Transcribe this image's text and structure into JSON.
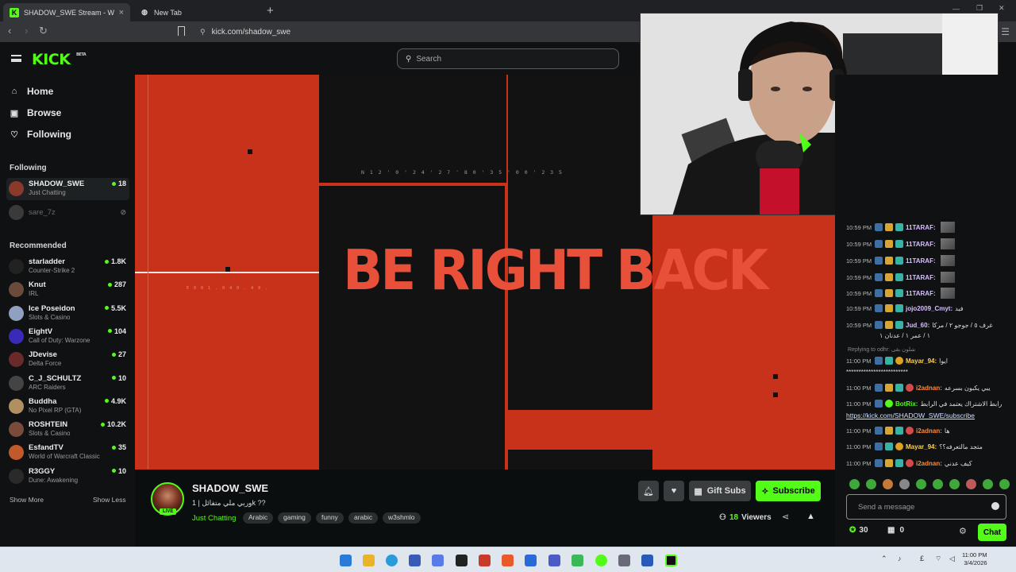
{
  "browser": {
    "tabs": [
      {
        "title": "SHADOW_SWE Stream - Watch",
        "active": true
      },
      {
        "title": "New Tab",
        "active": false
      }
    ],
    "url": "kick.com/shadow_swe"
  },
  "header": {
    "logo": "KICK",
    "logo_badge": "BETA",
    "search_placeholder": "Search"
  },
  "sidebar": {
    "nav": [
      {
        "label": "Home",
        "icon": "home-icon"
      },
      {
        "label": "Browse",
        "icon": "browse-icon"
      },
      {
        "label": "Following",
        "icon": "heart-icon"
      }
    ],
    "following_title": "Following",
    "following": [
      {
        "name": "SHADOW_SWE",
        "category": "Just Chatting",
        "viewers": "18",
        "color": "#8a3a2a"
      },
      {
        "name": "sare_7z",
        "category": "",
        "viewers": "",
        "offline": true
      }
    ],
    "recommended_title": "Recommended",
    "recommended": [
      {
        "name": "starladder",
        "category": "Counter-Strike 2",
        "viewers": "1.8K",
        "color": "#222"
      },
      {
        "name": "Knut",
        "category": "IRL",
        "viewers": "287",
        "color": "#6b4a3a"
      },
      {
        "name": "Ice Poseidon",
        "category": "Slots & Casino",
        "viewers": "5.5K",
        "color": "#8fa0c0"
      },
      {
        "name": "EightV",
        "category": "Call of Duty: Warzone",
        "viewers": "104",
        "color": "#3a2ab8"
      },
      {
        "name": "JDevise",
        "category": "Delta Force",
        "viewers": "27",
        "color": "#6a2a2a"
      },
      {
        "name": "C_J_SCHULTZ",
        "category": "ARC Raiders",
        "viewers": "10",
        "color": "#444"
      },
      {
        "name": "Buddha",
        "category": "No Pixel RP (GTA)",
        "viewers": "4.9K",
        "color": "#b09060"
      },
      {
        "name": "ROSHTEIN",
        "category": "Slots & Casino",
        "viewers": "10.2K",
        "color": "#7a4a3a"
      },
      {
        "name": "EsfandTV",
        "category": "World of Warcraft Classic",
        "viewers": "35",
        "color": "#c05a2a"
      },
      {
        "name": "R3GGY",
        "category": "Dune: Awakening",
        "viewers": "10",
        "color": "#2a2a2a"
      }
    ],
    "show_more": "Show More",
    "show_less": "Show Less"
  },
  "video": {
    "overlay_text": "BE RIGHT BACK",
    "coord_text": "N 1 2 ' 0 ' 2 4 ' 2 7 ' 8 0 ' 3 5 ' 0 0 ' 2 3 5",
    "small_text": "E 0 0 1 . 0 4 0 . 4 0 ."
  },
  "channel": {
    "name": "SHADOW_SWE",
    "live_badge": "LIVE",
    "title": "وربي ملي متفائل | 1k ??",
    "category": "Just Chatting",
    "tags": [
      "Arabic",
      "gaming",
      "funny",
      "arabic",
      "w3shmlo"
    ],
    "gift_label": "Gift Subs",
    "subscribe_label": "Subscribe",
    "viewers": "18",
    "viewers_label": "Viewers"
  },
  "chat": {
    "messages": [
      {
        "time": "10:59 PM",
        "user": "11TARAF:",
        "color": "#d8c0ff",
        "text": "",
        "emote": true
      },
      {
        "time": "10:59 PM",
        "user": "11TARAF:",
        "color": "#d8c0ff",
        "text": "",
        "emote": true
      },
      {
        "time": "10:59 PM",
        "user": "11TARAF:",
        "color": "#d8c0ff",
        "text": "",
        "emote": true
      },
      {
        "time": "10:59 PM",
        "user": "11TARAF:",
        "color": "#d8c0ff",
        "text": "",
        "emote": true
      },
      {
        "time": "10:59 PM",
        "user": "11TARAF:",
        "color": "#d8c0ff",
        "text": "",
        "emote": true
      },
      {
        "time": "10:59 PM",
        "user": "jojo2009_Cmyt:",
        "color": "#d8c0ff",
        "text": "فيد",
        "emote": false
      },
      {
        "time": "10:59 PM",
        "user": "Jud_60:",
        "color": "#d8c0ff",
        "text": "غرف ٥ / جوجو ٢ / مركا",
        "emote": false
      },
      {
        "time": "11:00 PM",
        "user": "Mayar_94:",
        "color": "#ffd24a",
        "text": "ايوا",
        "emote": false
      },
      {
        "time": "11:00 PM",
        "user": "i2adnan:",
        "color": "#ff8a3a",
        "text": "يبي يكبون بسرعه",
        "emote": false
      },
      {
        "time": "11:00 PM",
        "user": "BotRix:",
        "color": "#53fc18",
        "text": "رابط الاشتراك يعتمد في الرابط",
        "emote": false
      },
      {
        "time": "11:00 PM",
        "user": "i2adnan:",
        "color": "#ff8a3a",
        "text": "ها",
        "emote": false
      },
      {
        "time": "11:00 PM",
        "user": "Mayar_94:",
        "color": "#ffd24a",
        "text": "متجد مالتعرفه؟؟",
        "emote": false
      },
      {
        "time": "11:00 PM",
        "user": "i2adnan:",
        "color": "#ff8a3a",
        "text": "كيف عدني",
        "emote": false
      }
    ],
    "jud_line2": "١ / عمر ١ / عدنان ١",
    "reply_label": "Replying to odhr: شلون بقى",
    "mayar_line2": "*************************",
    "botrix_link": "https://kick.com/SHADOW_SWE/subscribe",
    "input_placeholder": "Send a message",
    "points": "30",
    "gifts": "0",
    "chat_button": "Chat"
  },
  "taskbar": {
    "time": "11:00 PM",
    "date": "3/4/2026"
  },
  "colors": {
    "kick_green": "#53fc18",
    "brb_red": "#c8311a"
  }
}
